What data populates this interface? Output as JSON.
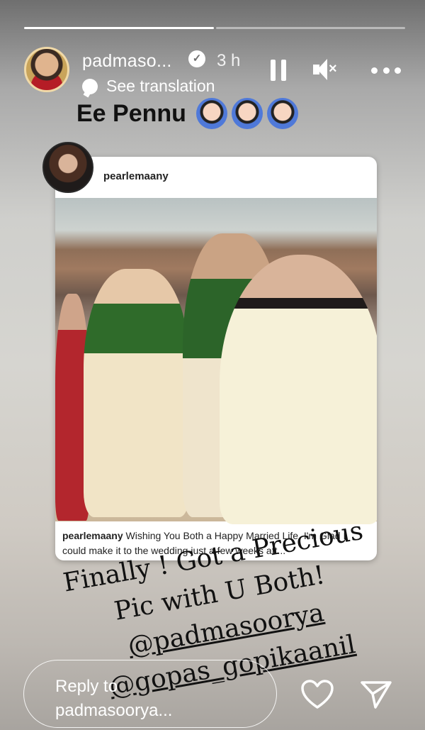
{
  "story": {
    "progress": {
      "segments": 2,
      "current": 1
    },
    "header": {
      "username": "padmaso...",
      "verified_icon": "verified-badge-icon",
      "time": "3 h"
    },
    "translate_label": "See translation",
    "caption": "Ee Pennu",
    "caption_emoji_icon": "woman-gesturing-ok-icon"
  },
  "post": {
    "username": "pearlemaany",
    "caption_username": "pearlemaany",
    "caption_text": "Wishing You Both a Happy Married Life. I'm Glad I could make it to the wedding just a few weeks aft..."
  },
  "overlay_text": {
    "line1": "Finally ! Got a Precious",
    "line2": "Pic with U Both!",
    "mention1": "@padmasoorya",
    "mention2": "@gopas_gopikaanil"
  },
  "reply": {
    "placeholder_line1": "Reply to",
    "placeholder_line2": "padmasoorya..."
  },
  "colors": {
    "accent": "#ffffff",
    "caption_text": "#111111"
  }
}
